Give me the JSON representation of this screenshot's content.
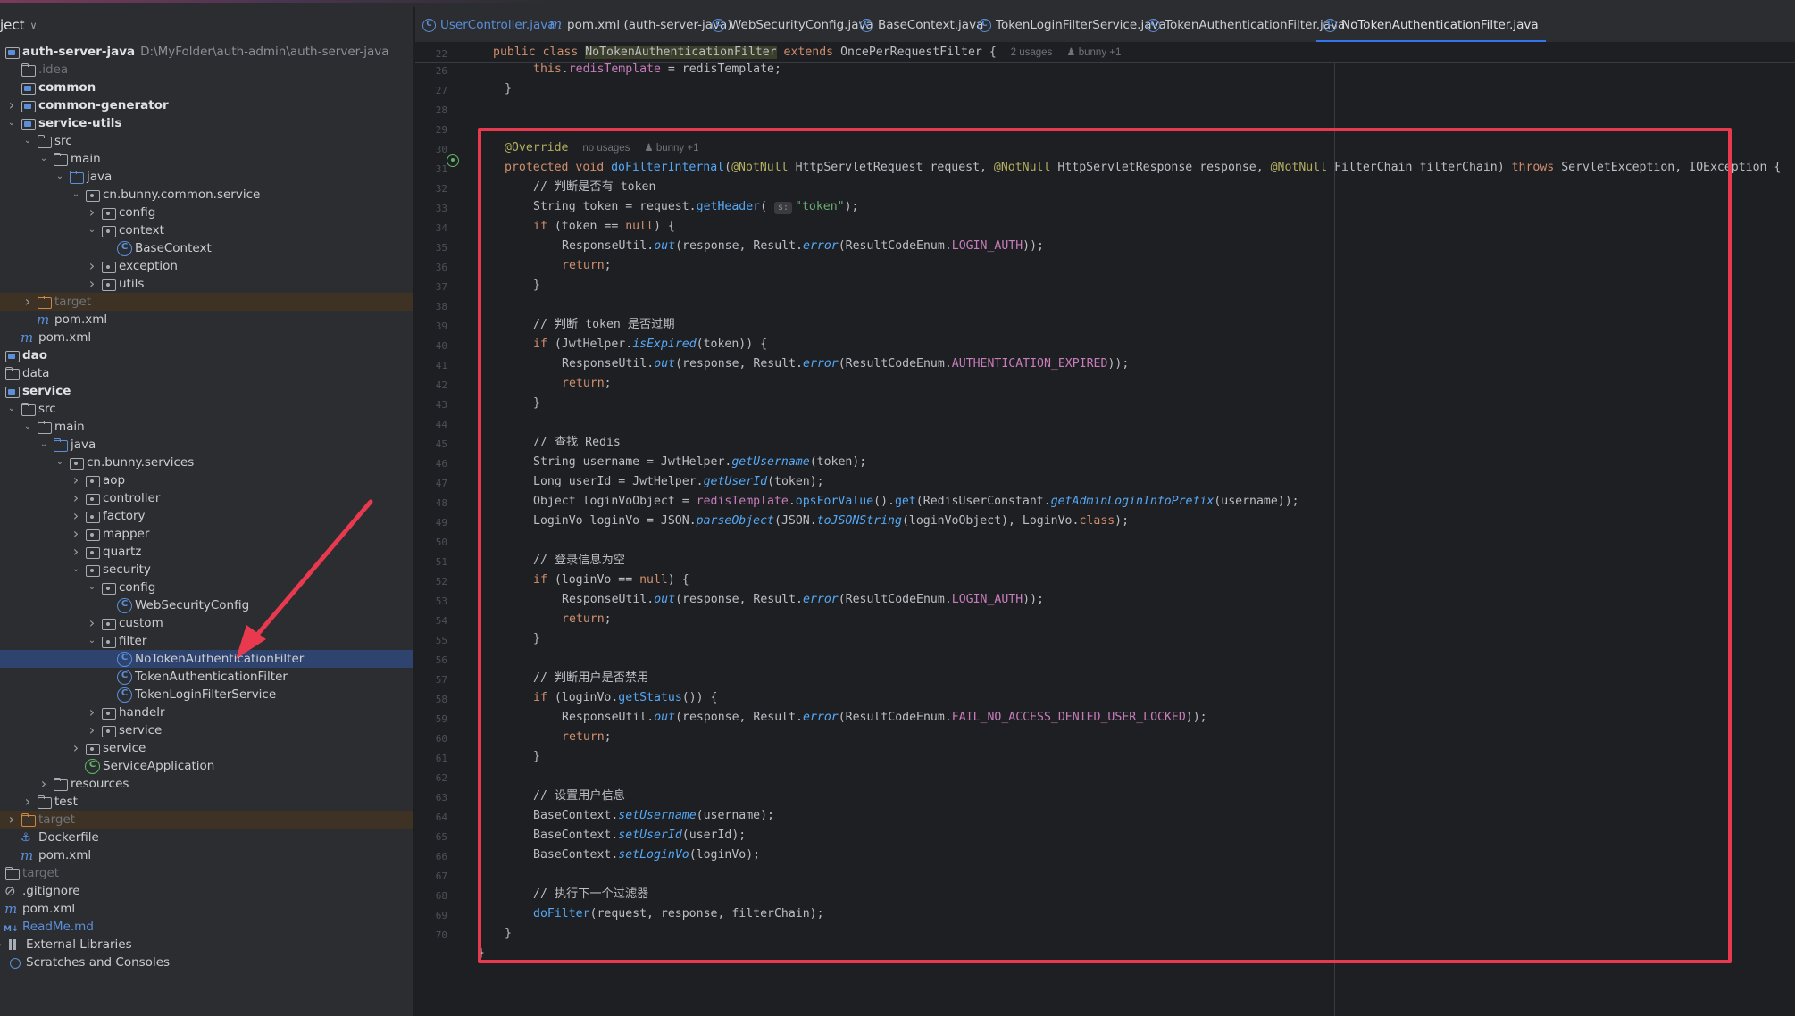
{
  "project": {
    "header": "ject",
    "tree": [
      {
        "depth": 0,
        "arrow": "open",
        "icon": "module",
        "label": "auth-server-java",
        "path": "D:\\MyFolder\\auth-admin\\auth-server-java",
        "style": "bold"
      },
      {
        "depth": 1,
        "arrow": "",
        "icon": "folder",
        "label": ".idea",
        "style": "dim"
      },
      {
        "depth": 1,
        "arrow": "",
        "icon": "module",
        "label": "common",
        "style": "bold"
      },
      {
        "depth": 1,
        "arrow": "closed",
        "icon": "module",
        "label": "common-generator",
        "style": "bold"
      },
      {
        "depth": 1,
        "arrow": "open",
        "icon": "module",
        "label": "service-utils",
        "style": "bold"
      },
      {
        "depth": 2,
        "arrow": "open",
        "icon": "folder",
        "label": "src"
      },
      {
        "depth": 3,
        "arrow": "open",
        "icon": "folder",
        "label": "main"
      },
      {
        "depth": 4,
        "arrow": "open",
        "icon": "srcf",
        "label": "java"
      },
      {
        "depth": 5,
        "arrow": "open",
        "icon": "pkg",
        "label": "cn.bunny.common.service"
      },
      {
        "depth": 6,
        "arrow": "closed",
        "icon": "pkg",
        "label": "config"
      },
      {
        "depth": 6,
        "arrow": "open",
        "icon": "pkg",
        "label": "context"
      },
      {
        "depth": 7,
        "arrow": "",
        "icon": "cls",
        "label": "BaseContext"
      },
      {
        "depth": 6,
        "arrow": "closed",
        "icon": "pkg",
        "label": "exception"
      },
      {
        "depth": 6,
        "arrow": "closed",
        "icon": "pkg",
        "label": "utils"
      },
      {
        "depth": 2,
        "arrow": "closed",
        "icon": "target",
        "label": "target",
        "style": "target"
      },
      {
        "depth": 2,
        "arrow": "",
        "icon": "maven",
        "label": "pom.xml"
      },
      {
        "depth": 1,
        "arrow": "",
        "icon": "maven",
        "label": "pom.xml"
      },
      {
        "depth": 0,
        "arrow": "",
        "icon": "module",
        "label": "dao",
        "style": "bold"
      },
      {
        "depth": 0,
        "arrow": "",
        "icon": "folder",
        "label": "data"
      },
      {
        "depth": 0,
        "arrow": "open",
        "icon": "module",
        "label": "service",
        "style": "bold"
      },
      {
        "depth": 1,
        "arrow": "open",
        "icon": "folder",
        "label": "src"
      },
      {
        "depth": 2,
        "arrow": "open",
        "icon": "folder",
        "label": "main"
      },
      {
        "depth": 3,
        "arrow": "open",
        "icon": "srcf",
        "label": "java"
      },
      {
        "depth": 4,
        "arrow": "open",
        "icon": "pkg",
        "label": "cn.bunny.services"
      },
      {
        "depth": 5,
        "arrow": "closed",
        "icon": "pkg",
        "label": "aop"
      },
      {
        "depth": 5,
        "arrow": "closed",
        "icon": "pkg",
        "label": "controller"
      },
      {
        "depth": 5,
        "arrow": "closed",
        "icon": "pkg",
        "label": "factory"
      },
      {
        "depth": 5,
        "arrow": "closed",
        "icon": "pkg",
        "label": "mapper"
      },
      {
        "depth": 5,
        "arrow": "closed",
        "icon": "pkg",
        "label": "quartz"
      },
      {
        "depth": 5,
        "arrow": "open",
        "icon": "pkg",
        "label": "security"
      },
      {
        "depth": 6,
        "arrow": "open",
        "icon": "pkg",
        "label": "config"
      },
      {
        "depth": 7,
        "arrow": "",
        "icon": "cls",
        "label": "WebSecurityConfig"
      },
      {
        "depth": 6,
        "arrow": "closed",
        "icon": "pkg",
        "label": "custom"
      },
      {
        "depth": 6,
        "arrow": "open",
        "icon": "pkg",
        "label": "filter"
      },
      {
        "depth": 7,
        "arrow": "",
        "icon": "cls",
        "label": "NoTokenAuthenticationFilter",
        "style": "selected"
      },
      {
        "depth": 7,
        "arrow": "",
        "icon": "cls",
        "label": "TokenAuthenticationFilter"
      },
      {
        "depth": 7,
        "arrow": "",
        "icon": "cls",
        "label": "TokenLoginFilterService"
      },
      {
        "depth": 6,
        "arrow": "closed",
        "icon": "pkg",
        "label": "handelr"
      },
      {
        "depth": 6,
        "arrow": "closed",
        "icon": "pkg",
        "label": "service"
      },
      {
        "depth": 5,
        "arrow": "closed",
        "icon": "pkg",
        "label": "service"
      },
      {
        "depth": 5,
        "arrow": "",
        "icon": "app",
        "label": "ServiceApplication"
      },
      {
        "depth": 3,
        "arrow": "closed",
        "icon": "folder",
        "label": "resources"
      },
      {
        "depth": 2,
        "arrow": "closed",
        "icon": "folder",
        "label": "test"
      },
      {
        "depth": 1,
        "arrow": "closed",
        "icon": "target",
        "label": "target",
        "style": "target"
      },
      {
        "depth": 1,
        "arrow": "",
        "icon": "docker",
        "label": "Dockerfile"
      },
      {
        "depth": 1,
        "arrow": "",
        "icon": "maven",
        "label": "pom.xml"
      },
      {
        "depth": 0,
        "arrow": "",
        "icon": "folder",
        "label": "target",
        "style": "dim"
      },
      {
        "depth": 0,
        "arrow": "",
        "icon": "ignore",
        "label": ".gitignore"
      },
      {
        "depth": 0,
        "arrow": "",
        "icon": "maven",
        "label": "pom.xml"
      },
      {
        "depth": 0,
        "arrow": "",
        "icon": "md",
        "label": "ReadMe.md",
        "style": "blue"
      },
      {
        "depth": -1,
        "arrow": "closed",
        "icon": "lib",
        "label": "External Libraries"
      },
      {
        "depth": -1,
        "arrow": "",
        "icon": "scratch",
        "label": "Scratches and Consoles"
      }
    ]
  },
  "tabs": [
    {
      "icon": "c",
      "label": "UserController.java",
      "style": "first"
    },
    {
      "icon": "m",
      "label": "pom.xml (auth-server-java)"
    },
    {
      "icon": "c",
      "label": "WebSecurityConfig.java"
    },
    {
      "icon": "c",
      "label": "BaseContext.java"
    },
    {
      "icon": "c",
      "label": "TokenLoginFilterService.java"
    },
    {
      "icon": "c",
      "label": "TokenAuthenticationFilter.java"
    },
    {
      "icon": "c",
      "label": "NoTokenAuthenticationFilter.java",
      "style": "active"
    }
  ],
  "editor": {
    "sticky": {
      "line": "22",
      "hint_usages": "2 usages",
      "hint_author": "bunny +1"
    },
    "override_hint_usages": "no usages",
    "override_hint_author": "bunny +1",
    "inlay_s": "s:",
    "line_numbers": [
      "26",
      "27",
      "28",
      "29",
      "30",
      "31",
      "32",
      "33",
      "34",
      "35",
      "36",
      "37",
      "38",
      "39",
      "40",
      "41",
      "42",
      "43",
      "44",
      "45",
      "46",
      "47",
      "48",
      "49",
      "50",
      "51",
      "52",
      "53",
      "54",
      "55",
      "56",
      "57",
      "58",
      "59",
      "60",
      "61",
      "62",
      "63",
      "64",
      "65",
      "66",
      "67",
      "68",
      "69",
      "70"
    ],
    "comments": {
      "c31": "// 判断是否有 token",
      "c38": "// 判断 token 是否过期",
      "c44": "// 查找 Redis",
      "c50": "// 登录信息为空",
      "c56": "// 判断用户是否禁用",
      "c62": "// 设置用户信息",
      "c67": "// 执行下一个过滤器"
    }
  },
  "colors": {
    "highlight_box": "#e8394f",
    "active_tab_underline": "#3574f0",
    "selection": "#2e436e"
  }
}
